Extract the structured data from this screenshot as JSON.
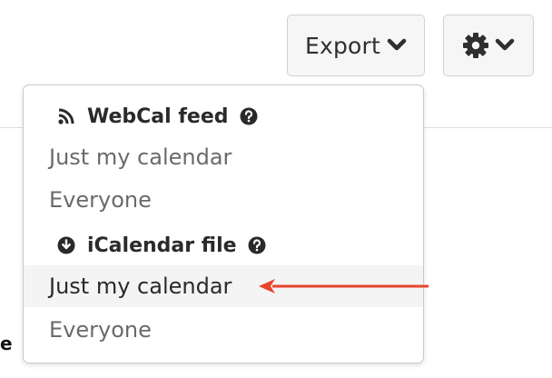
{
  "toolbar": {
    "export_label": "Export",
    "export_icon": "chevron-down-icon",
    "settings_icon": "gear-icon",
    "settings_chevron": "chevron-down-icon"
  },
  "menu": {
    "sections": [
      {
        "header": "WebCal feed",
        "icon": "rss-icon",
        "help_icon": "question-circle-icon",
        "items": [
          "Just my calendar",
          "Everyone"
        ]
      },
      {
        "header": "iCalendar file",
        "icon": "download-circle-icon",
        "help_icon": "question-circle-icon",
        "items": [
          "Just my calendar",
          "Everyone"
        ]
      }
    ],
    "highlighted_item": "iCalendar file / Just my calendar"
  },
  "background": {
    "partial_text": "e"
  },
  "colors": {
    "annotation_arrow": "#e8452c",
    "button_bg": "#f6f6f6",
    "highlight_bg": "#f4f4f4"
  }
}
